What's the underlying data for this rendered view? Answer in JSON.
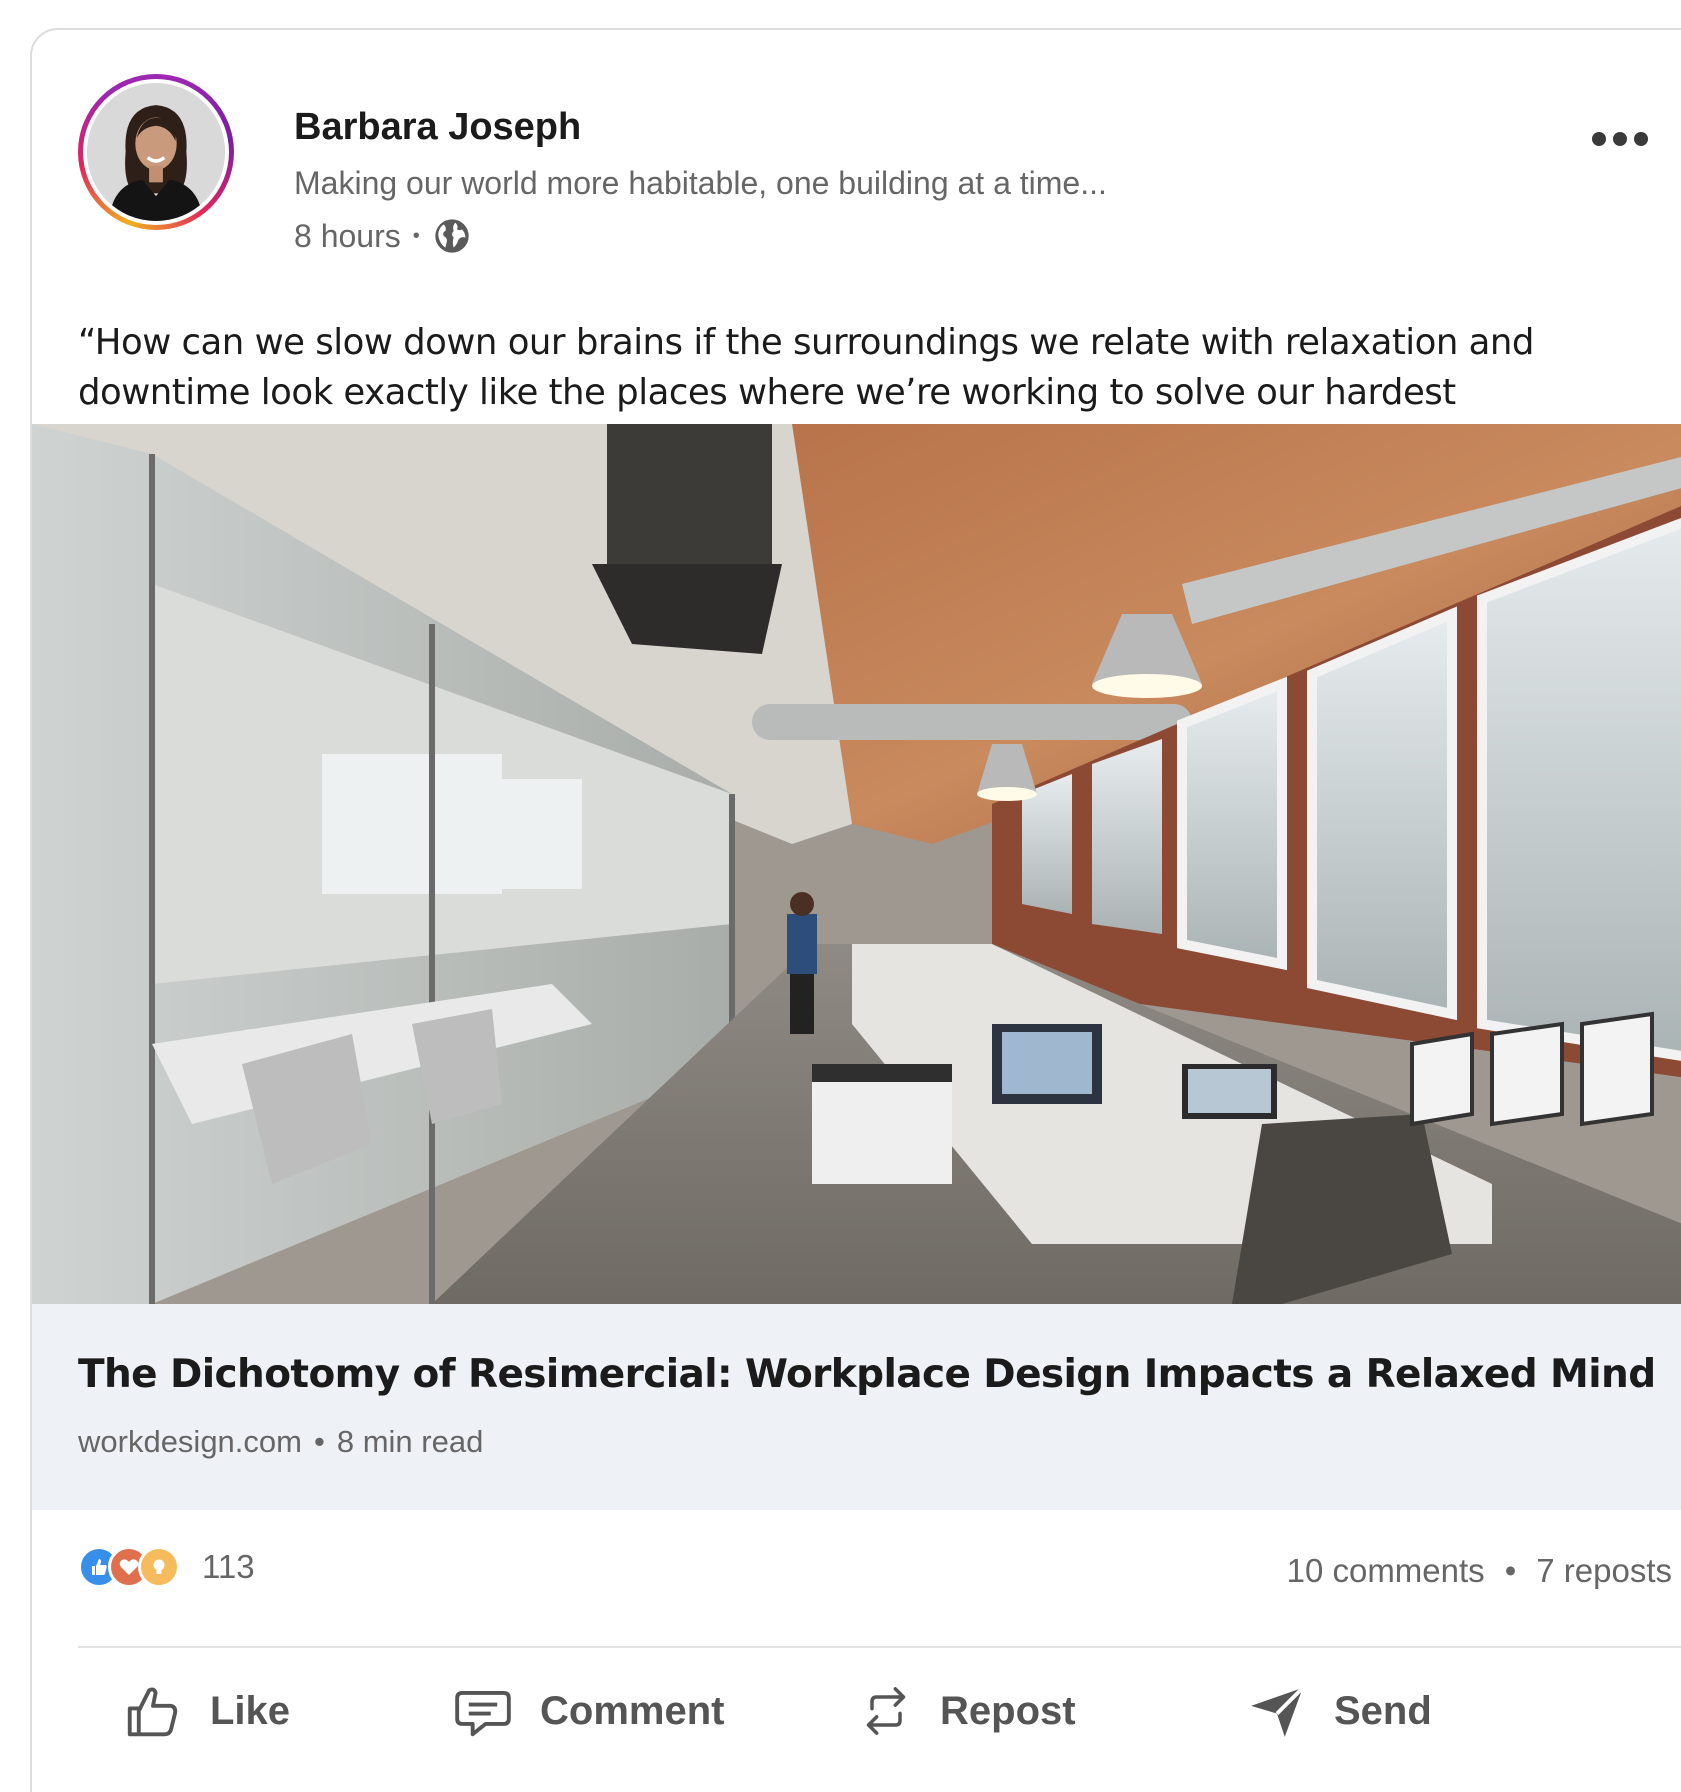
{
  "post": {
    "author_name": "Barbara Joseph",
    "author_headline": "Making our world more habitable, one building at a time...",
    "time_ago": "8 hours",
    "separator": "•",
    "visibility_icon": "globe-icon",
    "more_icon": "more-options-icon",
    "text": "“How can we slow down our brains if the surroundings we relate with relaxation and downtime look exactly like the places where we’re working to solve our hardest challenges?”"
  },
  "link": {
    "title": "The Dichotomy of Resimercial: Workplace Design Impacts a Relaxed Mind",
    "domain": "workdesign.com",
    "separator": "•",
    "read_time": "8 min read"
  },
  "stats": {
    "reaction_icons": [
      "like-reaction-icon",
      "love-reaction-icon",
      "insightful-reaction-icon"
    ],
    "reaction_count": "113",
    "comments": "10 comments",
    "separator": "•",
    "reposts": "7 reposts"
  },
  "actions": {
    "like": "Like",
    "comment": "Comment",
    "repost": "Repost",
    "send": "Send"
  },
  "colors": {
    "like_blue": "#378fe9",
    "love_red": "#df704d",
    "insight_yellow": "#f5bb5c",
    "link_box_bg": "#eef1f6",
    "secondary_text": "#666666"
  }
}
